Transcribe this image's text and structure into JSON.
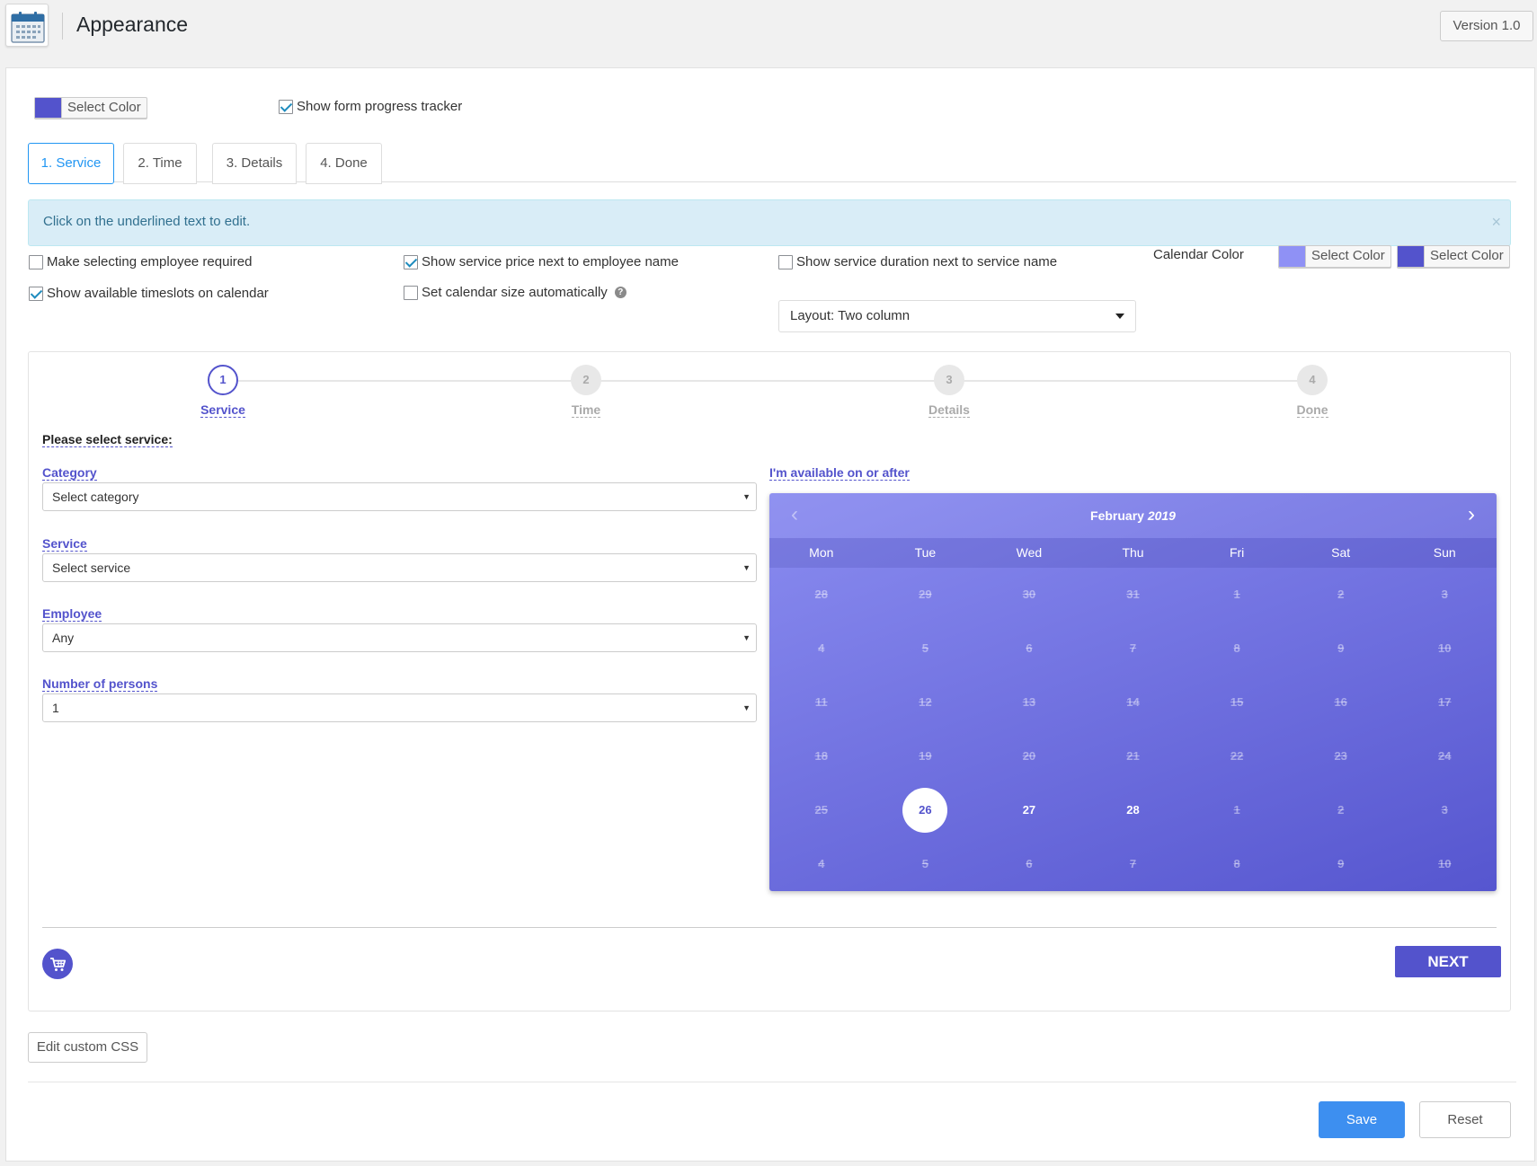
{
  "header": {
    "title": "Appearance",
    "version": "Version 1.0"
  },
  "top_controls": {
    "select_color_label": "Select Color",
    "primary_color": "#5353cc",
    "progress_tracker_label": "Show form progress tracker",
    "progress_tracker_checked": true
  },
  "tabs": [
    {
      "label": "1. Service",
      "active": true
    },
    {
      "label": "2. Time",
      "active": false
    },
    {
      "label": "3. Details",
      "active": false
    },
    {
      "label": "4. Done",
      "active": false
    }
  ],
  "info": {
    "text": "Click on the underlined text to edit.",
    "close": "×"
  },
  "options": {
    "employee_required": {
      "label": "Make selecting employee required",
      "checked": false
    },
    "timeslots_on_calendar": {
      "label": "Show available timeslots on calendar",
      "checked": true
    },
    "service_price": {
      "label": "Show service price next to employee name",
      "checked": true
    },
    "calendar_auto_size": {
      "label": "Set calendar size automatically",
      "checked": false
    },
    "service_duration": {
      "label": "Show service duration next to service name",
      "checked": false
    },
    "help_icon": "?",
    "layout_select": "Layout: Two column",
    "calendar_color_label": "Calendar Color",
    "calendar_color_1": {
      "label": "Select Color",
      "color": "#8f91f5"
    },
    "calendar_color_2": {
      "label": "Select Color",
      "color": "#5353cc"
    }
  },
  "preview": {
    "steps": [
      {
        "num": "1",
        "label": "Service",
        "active": true
      },
      {
        "num": "2",
        "label": "Time",
        "active": false
      },
      {
        "num": "3",
        "label": "Details",
        "active": false
      },
      {
        "num": "4",
        "label": "Done",
        "active": false
      }
    ],
    "please_select": "Please select service:",
    "category_label": "Category",
    "category_value": "Select category",
    "service_label": "Service",
    "service_value": "Select service",
    "employee_label": "Employee",
    "employee_value": "Any",
    "persons_label": "Number of persons",
    "persons_value": "1",
    "available_label": "I'm available on or after",
    "select_arrow": "▼",
    "next_button": "NEXT"
  },
  "calendar": {
    "month": "February",
    "year": "2019",
    "prev_icon": "‹",
    "next_icon": "›",
    "weekdays": [
      "Mon",
      "Tue",
      "Wed",
      "Thu",
      "Fri",
      "Sat",
      "Sun"
    ],
    "weeks": [
      [
        "28",
        "29",
        "30",
        "31",
        "1",
        "2",
        "3"
      ],
      [
        "4",
        "5",
        "6",
        "7",
        "8",
        "9",
        "10"
      ],
      [
        "11",
        "12",
        "13",
        "14",
        "15",
        "16",
        "17"
      ],
      [
        "18",
        "19",
        "20",
        "21",
        "22",
        "23",
        "24"
      ],
      [
        "25",
        "26",
        "27",
        "28",
        "1",
        "2",
        "3"
      ],
      [
        "4",
        "5",
        "6",
        "7",
        "8",
        "9",
        "10"
      ]
    ],
    "available_days": [
      "26",
      "27",
      "28"
    ],
    "selected_day": "26"
  },
  "footer": {
    "custom_css": "Edit custom CSS",
    "save": "Save",
    "reset": "Reset"
  }
}
